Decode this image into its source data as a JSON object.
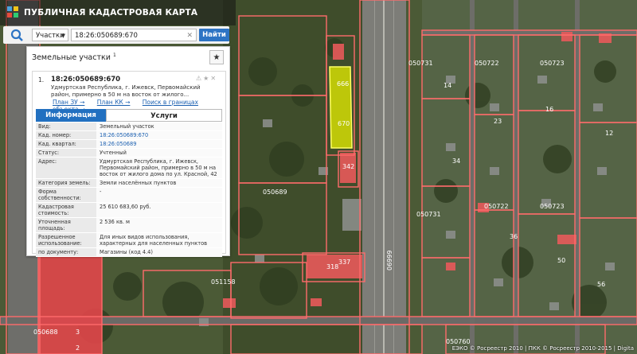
{
  "app": {
    "title": "ПУБЛИЧНАЯ КАДАСТРОВАЯ КАРТА"
  },
  "search": {
    "type_value": "Участки",
    "query_value": "18:26:050689:670",
    "button_label": "Найти",
    "clear_icon": "close-icon",
    "search_icon": "search-icon"
  },
  "panel": {
    "title": "Земельные участки",
    "title_count": "1",
    "result_number": "1.",
    "result_id": "18:26:050689:670",
    "result_address": "Удмуртская Республика, г. Ижевск, Первомайский район, примерно в 50 м на восток от жилого...",
    "links": [
      "План ЗУ →",
      "План КК →",
      "Поиск в границах объекта →"
    ],
    "tabs": [
      "Информация",
      "Услуги"
    ],
    "rows": [
      {
        "k": "Вид:",
        "v": "Земельный участок",
        "link": false
      },
      {
        "k": "Кад. номер:",
        "v": "18:26:050689:670",
        "link": true
      },
      {
        "k": "Кад. квартал:",
        "v": "18:26:050689",
        "link": true
      },
      {
        "k": "Статус:",
        "v": "Учтенный",
        "link": false
      },
      {
        "k": "Адрес:",
        "v": "Удмуртская Республика, г. Ижевск, Первомайский район, примерно в 50 м на восток от жилого дома по ул. Красной, 42",
        "link": false
      },
      {
        "k": "Категория земель:",
        "v": "Земли населённых пунктов",
        "link": false
      },
      {
        "k": "Форма собственности:",
        "v": "-",
        "link": false
      },
      {
        "k": "Кадастровая стоимость:",
        "v": "25 610 683,60 руб.",
        "link": false
      },
      {
        "k": "Уточненная площадь:",
        "v": "2 536 кв. м",
        "link": false
      },
      {
        "k": "Разрешенное использование:",
        "v": "Для иных видов использования, характерных для населенных пунктов",
        "link": false
      },
      {
        "k": "по документу:",
        "v": "Магазины (код 4.4)",
        "link": false
      }
    ]
  },
  "map": {
    "quarter_labels": [
      "050731",
      "050722",
      "050723",
      "050731",
      "050722",
      "050723",
      "050689",
      "051158",
      "050688",
      "050760"
    ],
    "street_label": "06999",
    "parcel_labels": [
      "666",
      "670",
      "342",
      "318",
      "337",
      "3",
      "2",
      "14",
      "23",
      "16",
      "12",
      "34",
      "36",
      "50",
      "56"
    ]
  },
  "footer": "ЕЭКО © Росреестр 2010 | ПКК © Росреестр 2010-2015 | Digita",
  "colors": {
    "boundary": "#ff6b6b",
    "selected": "#e8f000",
    "button": "#2d74c4"
  }
}
